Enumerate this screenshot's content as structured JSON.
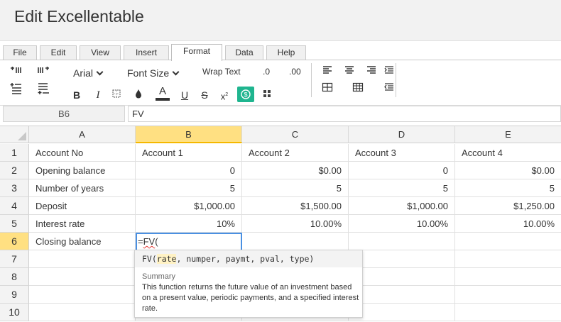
{
  "app": {
    "title": "Edit Excellentable"
  },
  "tabs": [
    "File",
    "Edit",
    "View",
    "Insert",
    "Format",
    "Data",
    "Help"
  ],
  "active_tab": "Format",
  "ribbon": {
    "font_family": "Arial",
    "font_size_label": "Font Size",
    "wrap_text": "Wrap Text",
    "decrease_decimal": ".0",
    "increase_decimal": ".00",
    "bold": "B",
    "italic": "I",
    "font_color": "A",
    "underline": "U",
    "strikethrough": "S",
    "superscript": "x",
    "accent_color": "#1fb58f"
  },
  "formula_bar": {
    "cell_ref": "B6",
    "content": "FV"
  },
  "columns": [
    "A",
    "B",
    "C",
    "D",
    "E"
  ],
  "selected_column": "B",
  "selected_row": "6",
  "rows": [
    {
      "num": "1",
      "cells": [
        "Account No",
        "Account 1",
        "Account 2",
        "Account 3",
        "Account 4"
      ]
    },
    {
      "num": "2",
      "cells": [
        "Opening balance",
        "0",
        "$0.00",
        "0",
        "$0.00"
      ]
    },
    {
      "num": "3",
      "cells": [
        "Number of years",
        "5",
        "5",
        "5",
        "5"
      ]
    },
    {
      "num": "4",
      "cells": [
        "Deposit",
        "$1,000.00",
        "$1,500.00",
        "$1,000.00",
        "$1,250.00"
      ]
    },
    {
      "num": "5",
      "cells": [
        "Interest rate",
        "10%",
        "10.00%",
        "10.00%",
        "10.00%"
      ]
    },
    {
      "num": "6",
      "cells": [
        "Closing balance",
        "",
        "",
        "",
        ""
      ]
    },
    {
      "num": "7",
      "cells": [
        "",
        "",
        "",
        "",
        ""
      ]
    },
    {
      "num": "8",
      "cells": [
        "",
        "",
        "",
        "",
        ""
      ]
    },
    {
      "num": "9",
      "cells": [
        "",
        "",
        "",
        "",
        ""
      ]
    },
    {
      "num": "10",
      "cells": [
        "",
        "",
        "",
        "",
        ""
      ]
    }
  ],
  "editing": {
    "prefix": "=",
    "func": "FV",
    "suffix": "("
  },
  "tooltip": {
    "sig_func": "FV(",
    "sig_param_active": "rate",
    "sig_rest": ", numper, paymt, pval, type)",
    "summary_label": "Summary",
    "summary": "This function returns the future value of an investment based on a present value, periodic payments, and a specified interest rate."
  }
}
